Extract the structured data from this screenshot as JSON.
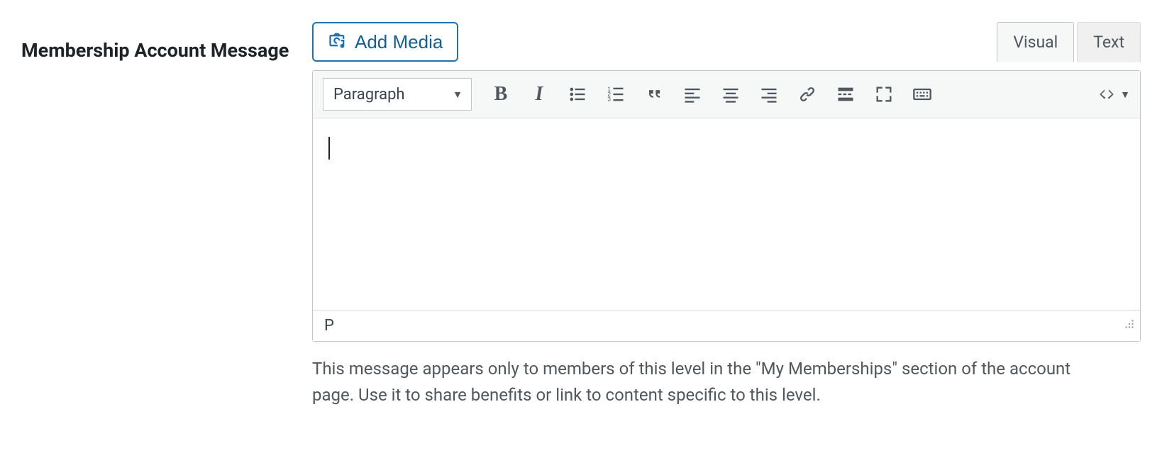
{
  "field": {
    "label": "Membership Account Message"
  },
  "editor": {
    "add_media_label": "Add Media",
    "tabs": {
      "visual": "Visual",
      "text": "Text"
    },
    "format_select": "Paragraph",
    "content": "",
    "path_display": "P"
  },
  "help": "This message appears only to members of this level in the \"My Memberships\" section of the account page. Use it to share benefits or link to content specific to this level."
}
